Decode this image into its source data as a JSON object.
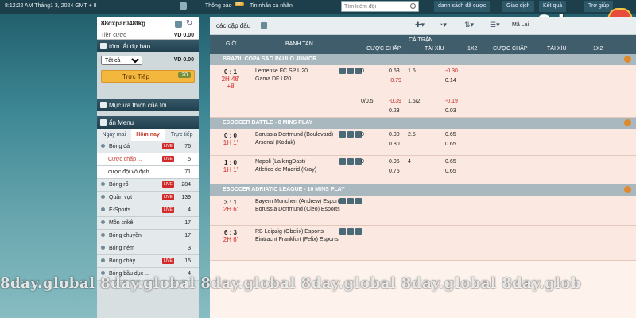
{
  "topbar": {
    "datetime": "8:12:22 AM Tháng1 3, 2024 GMT + 8",
    "notice": "Thông báo",
    "notice_badge": "Info",
    "messages": "Tin nhắn cá nhân",
    "search_placeholder": "Tìm kiếm đội",
    "nav": [
      "danh sách đã cược",
      "Giao dịch",
      "Kết quả",
      "Trợ giúp"
    ]
  },
  "logo": {
    "text": "8day"
  },
  "account": {
    "username": "88dxpar048fkg",
    "credit_label": "Tiền cược",
    "credit_value": "VD 0.00"
  },
  "bet_summary": {
    "header": "tóm tắt dự báo",
    "select_value": "Tất cả",
    "amount": "VD 0.00",
    "live_label": "Trực Tiếp",
    "live_count": "20"
  },
  "favorites": {
    "header": "Mục ưa thích của tôi"
  },
  "menu": {
    "header": "ẩn Menu",
    "tabs": [
      "Ngày mai",
      "Hôm nay",
      "Trực tiếp"
    ],
    "active_tab": "Hôm nay",
    "items": [
      {
        "name": "Bóng đá",
        "live": "LIVE",
        "count": "76"
      },
      {
        "name": "Cược chấp ...",
        "live": "LIVE",
        "count": "5",
        "sub": true,
        "highlight": true
      },
      {
        "name": "cược đội vô địch",
        "count": "71",
        "sub": true
      },
      {
        "name": "Bóng rổ",
        "live": "LIVE",
        "count": "284"
      },
      {
        "name": "Quần vợt",
        "live": "LIVE",
        "count": "139"
      },
      {
        "name": "E-Sports",
        "live": "LIVE",
        "count": "4"
      },
      {
        "name": "Môn crikê",
        "count": "17"
      },
      {
        "name": "Bóng chuyền",
        "count": "17"
      },
      {
        "name": "Bóng ném",
        "count": "3"
      },
      {
        "name": "Bóng chày",
        "live": "LIVE",
        "count": "15"
      },
      {
        "name": "Bóng bầu dục ...",
        "count": "4"
      }
    ]
  },
  "main": {
    "title": "các cặp đấu",
    "view_label": "Mã Lai",
    "headers": {
      "time": "GIỜ",
      "match": "BANH TAN",
      "full": "CẢ TRẬN",
      "hdp": "CƯỢC CHẤP",
      "ou": "TÀI XỈU",
      "x12": "1X2",
      "hdp2": "CƯỢC CHẤP",
      "ou2": "TÀI XỈU",
      "x122": "1X2"
    },
    "leagues": [
      {
        "name": "BRAZIL COPA SAO PAULO JUNIOR",
        "matches": [
          {
            "score": "0 : 1",
            "minute": "2H 48'",
            "extra": "+8",
            "home": "Lemense FC SP U20",
            "away": "Gama DF U20",
            "hdp": "0",
            "h1": "0.63",
            "ou": "1.5",
            "h2": "-0.30",
            "a1": "-0.79",
            "a2": "0.14",
            "h1red": false,
            "h2red": true,
            "a1red": true,
            "a2red": false
          },
          {
            "score": "",
            "minute": "",
            "extra": "",
            "home": "",
            "away": "",
            "hdp": "0/0.5",
            "h1": "-0.39",
            "ou": "1.5/2",
            "h2": "-0.19",
            "a1": "0.23",
            "a2": "0.03",
            "h1red": true,
            "h2red": true,
            "a1red": false,
            "a2red": false
          }
        ]
      },
      {
        "name": "ESOCCER BATTLE - 8 MINS PLAY",
        "matches": [
          {
            "score": "0 : 0",
            "minute": "1H 1'",
            "extra": "",
            "home": "Borussia Dortmund (Boulevard)",
            "away": "Arsenal (Kodak)",
            "hdp": "0",
            "h1": "0.90",
            "ou": "2.5",
            "h2": "0.65",
            "a1": "0.80",
            "a2": "0.65",
            "h1red": false,
            "h2red": false,
            "a1red": false,
            "a2red": false
          },
          {
            "score": "1 : 0",
            "minute": "1H 1'",
            "extra": "",
            "home": "Napoli (LaikingDast)",
            "away": "Atletico de Madrid (Kray)",
            "hdp": "0",
            "h1": "0.95",
            "ou": "4",
            "h2": "0.65",
            "a1": "0.75",
            "a2": "0.65",
            "h1red": false,
            "h2red": false,
            "a1red": false,
            "a2red": false
          }
        ]
      },
      {
        "name": "ESOCCER ADRIATIC LEAGUE - 10 MINS PLAY",
        "matches": [
          {
            "score": "3 : 1",
            "minute": "2H 6'",
            "extra": "",
            "home": "Bayern Munchen (Andrew) Esports",
            "away": "Borussia Dortmund (Cleo) Esports",
            "hdp": "",
            "h1": "",
            "ou": "",
            "h2": "",
            "a1": "",
            "a2": ""
          },
          {
            "score": "6 : 3",
            "minute": "2H 6'",
            "extra": "",
            "home": "RB Leipzig (Obelix) Esports",
            "away": "Eintracht Frankfurt (Felix) Esports",
            "hdp": "",
            "h1": "",
            "ou": "",
            "h2": "",
            "a1": "",
            "a2": ""
          }
        ]
      }
    ]
  },
  "watermark": "8day.global  8day.global  8day.global  8day.global  8day.global  8day.glob"
}
